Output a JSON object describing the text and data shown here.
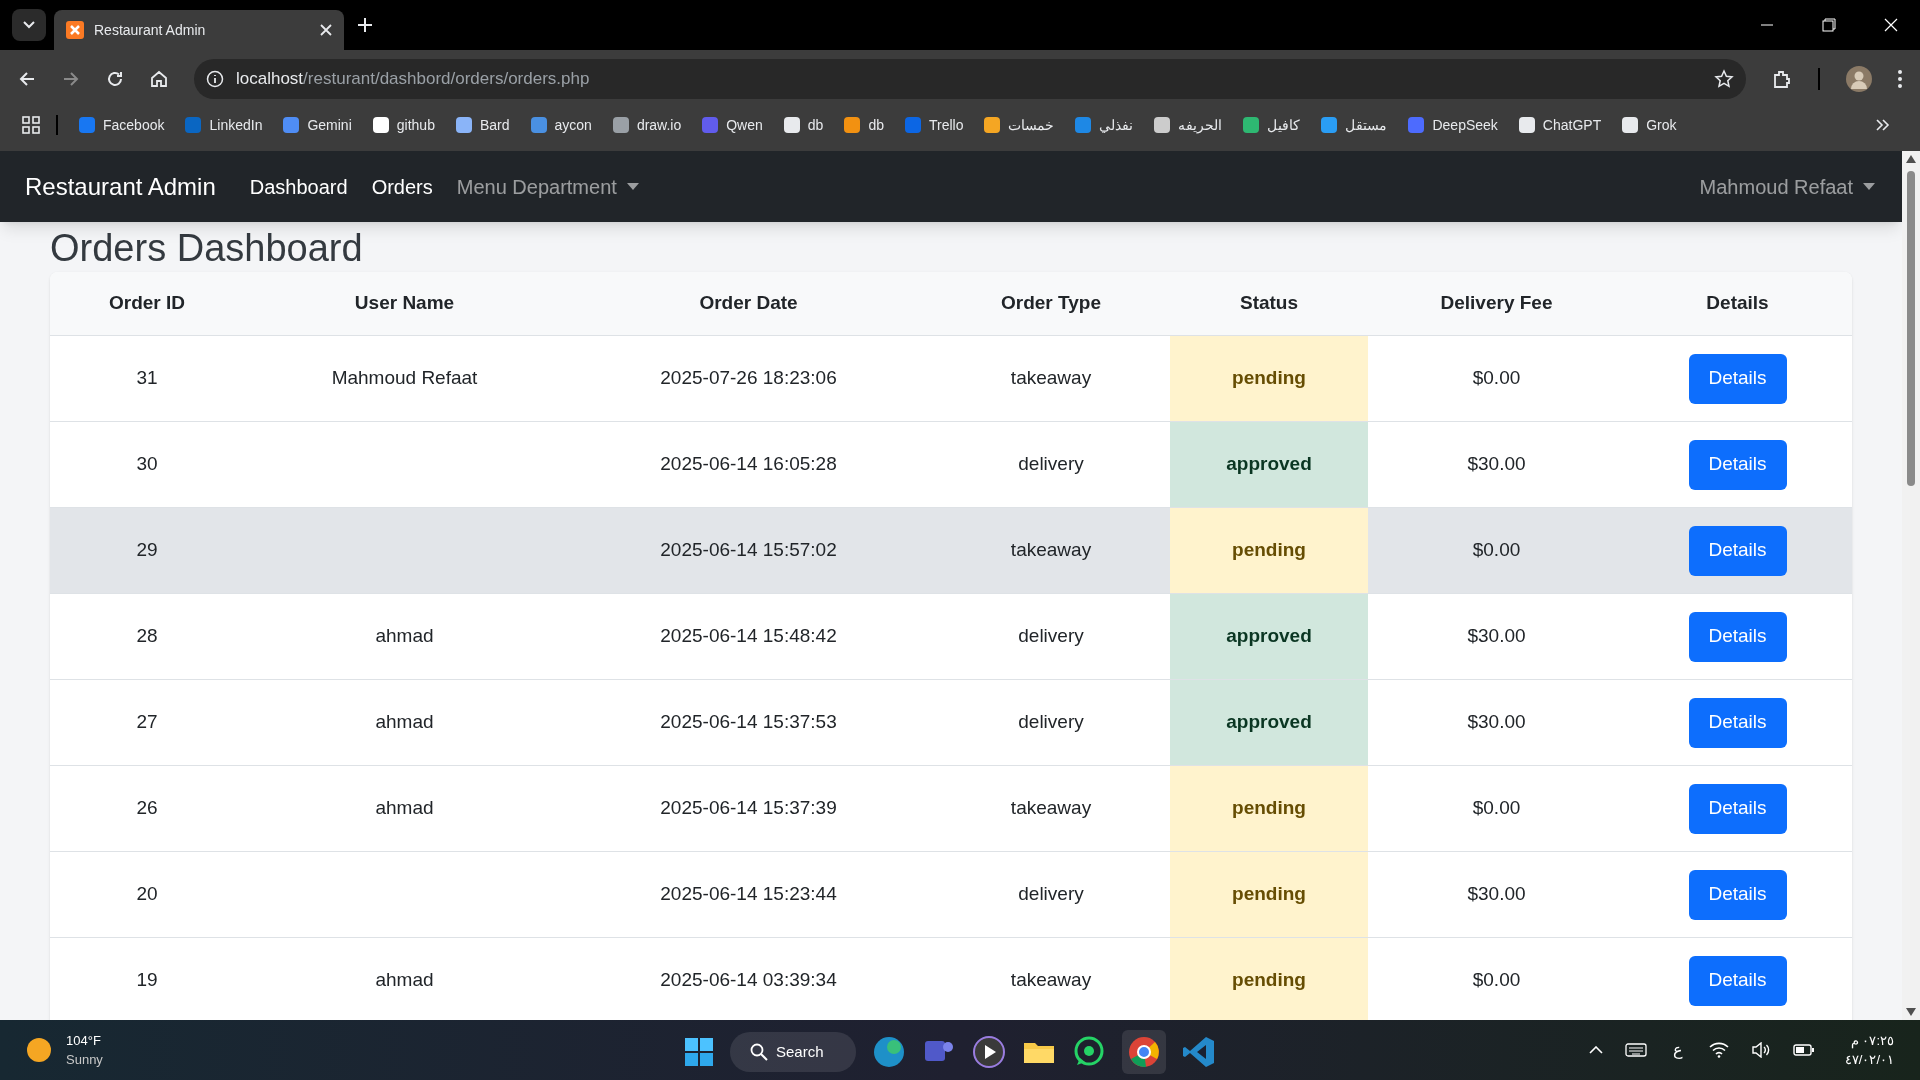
{
  "browser": {
    "tab_title": "Restaurant Admin",
    "url_host": "localhost",
    "url_path": "/resturant/dashbord/orders/orders.php",
    "bookmarks": [
      {
        "label": "Facebook",
        "color": "#1877f2"
      },
      {
        "label": "LinkedIn",
        "color": "#0a66c2"
      },
      {
        "label": "Gemini",
        "color": "#4f8df5"
      },
      {
        "label": "github",
        "color": "#ffffff"
      },
      {
        "label": "Bard",
        "color": "#8ab4f8"
      },
      {
        "label": "aycon",
        "color": "#4a90e2"
      },
      {
        "label": "draw.io",
        "color": "#9aa0a6"
      },
      {
        "label": "Qwen",
        "color": "#615ced"
      },
      {
        "label": "db",
        "color": "#e8eaed"
      },
      {
        "label": "db",
        "color": "#f29111"
      },
      {
        "label": "Trello",
        "color": "#0c66e4"
      },
      {
        "label": "خمسات",
        "color": "#f5a623"
      },
      {
        "label": "نفذلي",
        "color": "#1e88e5"
      },
      {
        "label": "الحريفه",
        "color": "#cccccc"
      },
      {
        "label": "كافيل",
        "color": "#2eb872"
      },
      {
        "label": "مستقل",
        "color": "#2a9df4"
      },
      {
        "label": "DeepSeek",
        "color": "#4d6bfe"
      },
      {
        "label": "ChatGPT",
        "color": "#e8eaed"
      },
      {
        "label": "Grok",
        "color": "#e8eaed"
      }
    ]
  },
  "navbar": {
    "brand": "Restaurant Admin",
    "links": [
      {
        "label": "Dashboard",
        "kind": "link"
      },
      {
        "label": "Orders",
        "kind": "link"
      },
      {
        "label": "Menu Department",
        "kind": "dropdown"
      }
    ],
    "user": "Mahmoud Refaat"
  },
  "page_title": "Orders Dashboard",
  "table": {
    "columns": [
      "Order ID",
      "User Name",
      "Order Date",
      "Order Type",
      "Status",
      "Delivery Fee",
      "Details"
    ],
    "rows": [
      {
        "id": "31",
        "user": "Mahmoud Refaat",
        "date": "2025-07-26 18:23:06",
        "type": "takeaway",
        "status": "pending",
        "kind": "pending",
        "fee": "$0.00",
        "action": "Details",
        "hovered": false
      },
      {
        "id": "30",
        "date": "2025-06-14 16:05:28",
        "type": "delivery",
        "status": "approved",
        "kind": "approved",
        "fee": "$30.00",
        "action": "Details",
        "hovered": false
      },
      {
        "id": "29",
        "date": "2025-06-14 15:57:02",
        "type": "takeaway",
        "status": "pending",
        "kind": "pending",
        "fee": "$0.00",
        "action": "Details",
        "hovered": true
      },
      {
        "id": "28",
        "user": "ahmad",
        "date": "2025-06-14 15:48:42",
        "type": "delivery",
        "status": "approved",
        "kind": "approved",
        "fee": "$30.00",
        "action": "Details",
        "hovered": false
      },
      {
        "id": "27",
        "user": "ahmad",
        "date": "2025-06-14 15:37:53",
        "type": "delivery",
        "status": "approved",
        "kind": "approved",
        "fee": "$30.00",
        "action": "Details",
        "hovered": false
      },
      {
        "id": "26",
        "user": "ahmad",
        "date": "2025-06-14 15:37:39",
        "type": "takeaway",
        "status": "pending",
        "kind": "pending",
        "fee": "$0.00",
        "action": "Details",
        "hovered": false
      },
      {
        "id": "20",
        "date": "2025-06-14 15:23:44",
        "type": "delivery",
        "status": "pending",
        "kind": "pending",
        "fee": "$30.00",
        "action": "Details",
        "hovered": false
      },
      {
        "id": "19",
        "user": "ahmad",
        "date": "2025-06-14 03:39:34",
        "type": "takeaway",
        "status": "pending",
        "kind": "pending",
        "fee": "$0.00",
        "action": "Details",
        "hovered": false
      }
    ]
  },
  "taskbar": {
    "temperature": "104°F",
    "weather": "Sunny",
    "search": "Search",
    "language": "ع",
    "time": "٠٧:٢٥ م",
    "date": "٤٧/٠٢/٠١"
  }
}
